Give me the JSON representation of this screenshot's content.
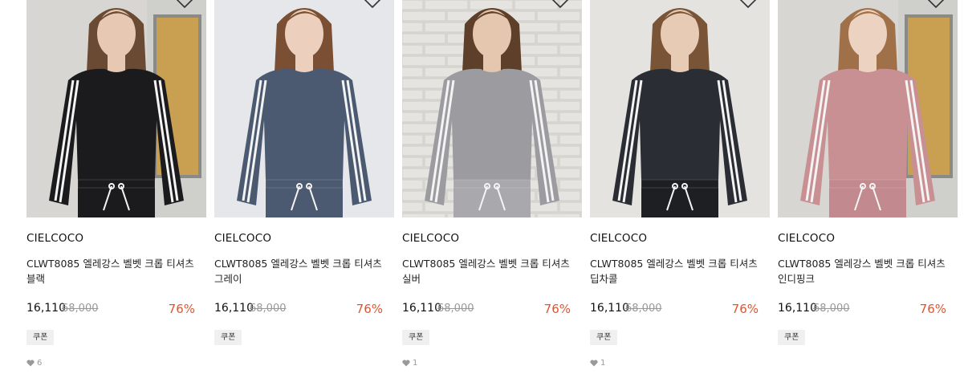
{
  "products": [
    {
      "brand": "CIELCOCO",
      "name": "CLWT8085 엘레강스 벨벳 크롭 티셔츠 블랙",
      "price": "16,110",
      "original_price": "68,000",
      "discount": "76%",
      "badge": "쿠폰",
      "likes": "6",
      "image": {
        "bg": "#d8d6d2",
        "top": "#1b1b1d",
        "bottom": "#1b1b1d",
        "hair": "#6a4a32",
        "skin": "#e7c8b2",
        "backdrop": "door"
      }
    },
    {
      "brand": "CIELCOCO",
      "name": "CLWT8085 엘레강스 벨벳 크롭 티셔츠 그레이",
      "price": "16,110",
      "original_price": "68,000",
      "discount": "76%",
      "badge": "쿠폰",
      "likes": "",
      "image": {
        "bg": "#e5e7ea",
        "top": "#4b5a70",
        "bottom": "#4b5a70",
        "hair": "#7a4f33",
        "skin": "#ecd0bd",
        "backdrop": "plain"
      }
    },
    {
      "brand": "CIELCOCO",
      "name": "CLWT8085 엘레강스 벨벳 크롭 티셔츠 실버",
      "price": "16,110",
      "original_price": "68,000",
      "discount": "76%",
      "badge": "쿠폰",
      "likes": "1",
      "image": {
        "bg": "#dedcd8",
        "top": "#9c9ca0",
        "bottom": "#a9a9ad",
        "hair": "#5e3f2a",
        "skin": "#e5c6ae",
        "backdrop": "brick"
      }
    },
    {
      "brand": "CIELCOCO",
      "name": "CLWT8085 엘레강스 벨벳 크롭 티셔츠 딥차콜",
      "price": "16,110",
      "original_price": "68,000",
      "discount": "76%",
      "badge": "쿠폰",
      "likes": "1",
      "image": {
        "bg": "#e4e3e0",
        "top": "#2b2d34",
        "bottom": "#1e1f23",
        "hair": "#7a5436",
        "skin": "#e8cbb5",
        "backdrop": "plain"
      }
    },
    {
      "brand": "CIELCOCO",
      "name": "CLWT8085 엘레강스 벨벳 크롭 티셔츠 인디핑크",
      "price": "16,110",
      "original_price": "68,000",
      "discount": "76%",
      "badge": "쿠폰",
      "likes": "",
      "image": {
        "bg": "#d8d6d2",
        "top": "#c99094",
        "bottom": "#c28a8e",
        "hair": "#a07048",
        "skin": "#ecd2c0",
        "backdrop": "door"
      }
    }
  ]
}
